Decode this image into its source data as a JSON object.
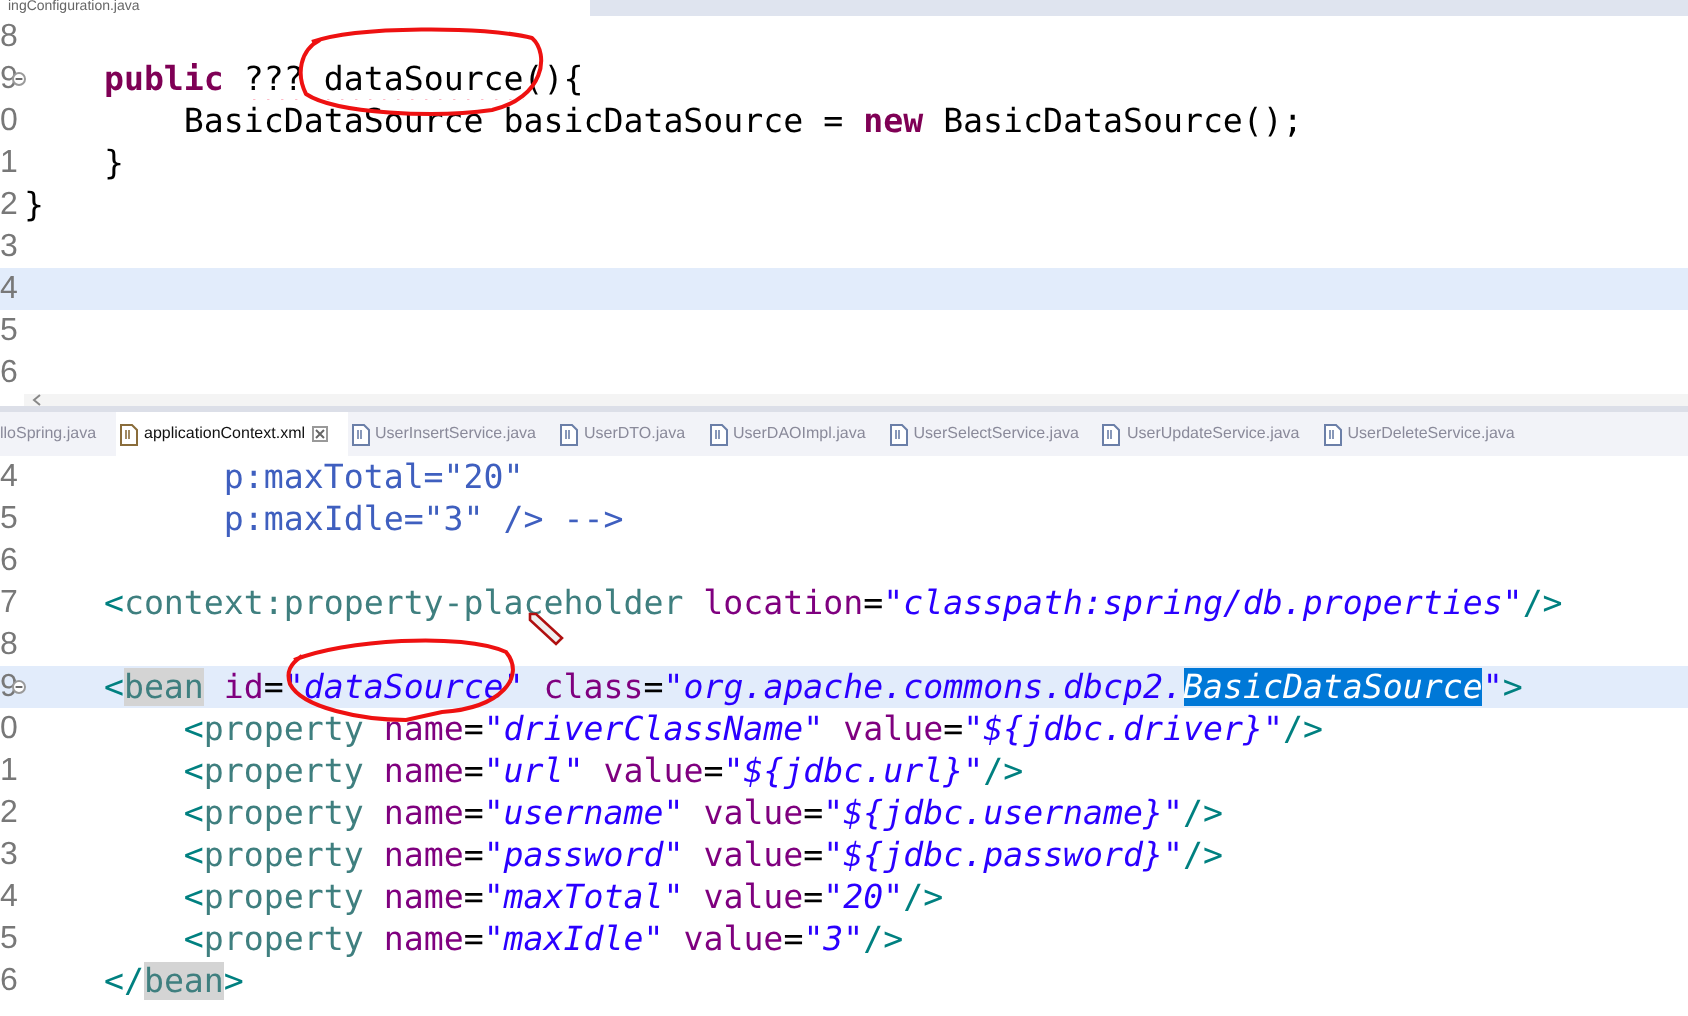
{
  "top_editor": {
    "tab": {
      "label": "ingConfiguration.java",
      "selected": true
    },
    "lines": [
      {
        "number": "8",
        "current": false
      },
      {
        "number": "9",
        "current": false,
        "foldable": true,
        "tokens": [
          {
            "kind": "keyword",
            "text": "    public "
          },
          {
            "kind": "error",
            "text": "???"
          },
          {
            "kind": "error",
            "text": " dataSource"
          },
          {
            "kind": "plain",
            "text": "(){"
          }
        ]
      },
      {
        "number": "0",
        "current": false,
        "tokens": [
          {
            "kind": "plain",
            "text": "        BasicDataSource basicDataSource = "
          },
          {
            "kind": "keyword",
            "text": "new"
          },
          {
            "kind": "plain",
            "text": " BasicDataSource();"
          }
        ]
      },
      {
        "number": "1",
        "current": false,
        "tokens": [
          {
            "kind": "plain",
            "text": "    }"
          }
        ]
      },
      {
        "number": "2",
        "current": false,
        "tokens": [
          {
            "kind": "plain",
            "text": "}"
          }
        ]
      },
      {
        "number": "3",
        "current": false
      },
      {
        "number": "4",
        "current": true
      },
      {
        "number": "5",
        "current": false
      },
      {
        "number": "6",
        "current": false
      }
    ]
  },
  "bottom_editor": {
    "tabs": [
      {
        "label": "lloSpring.java",
        "selected": false
      },
      {
        "label": "applicationContext.xml",
        "selected": true,
        "kind": "xml"
      },
      {
        "label": "UserInsertService.java",
        "selected": false,
        "kind": "java"
      },
      {
        "label": "UserDTO.java",
        "selected": false,
        "kind": "java"
      },
      {
        "label": "UserDAOImpl.java",
        "selected": false,
        "kind": "java"
      },
      {
        "label": "UserSelectService.java",
        "selected": false,
        "kind": "java"
      },
      {
        "label": "UserUpdateService.java",
        "selected": false,
        "kind": "java"
      },
      {
        "label": "UserDeleteService.java",
        "selected": false,
        "kind": "java"
      }
    ],
    "lines": [
      {
        "number": "4",
        "current": false,
        "tokens": [
          {
            "kind": "comment",
            "text": "          p:maxTotal=\"20\""
          }
        ]
      },
      {
        "number": "5",
        "current": false,
        "tokens": [
          {
            "kind": "comment",
            "text": "          p:maxIdle=\"3\" /> -->"
          }
        ]
      },
      {
        "number": "6",
        "current": false
      },
      {
        "number": "7",
        "current": false,
        "tokens": [
          {
            "kind": "tag",
            "text": "    <"
          },
          {
            "kind": "tagname",
            "text": "context:property-placeholder"
          },
          {
            "kind": "attr",
            "text": " location"
          },
          {
            "kind": "plain",
            "text": "="
          },
          {
            "kind": "string",
            "text": "\"classpath:spring/db.properties\""
          },
          {
            "kind": "tag",
            "text": "/>"
          }
        ]
      },
      {
        "number": "8",
        "current": false
      },
      {
        "number": "9",
        "current": true,
        "foldable": true,
        "tokens": [
          {
            "kind": "tag",
            "text": "    <"
          },
          {
            "kind": "occurrence",
            "text": "bean"
          },
          {
            "kind": "attr",
            "text": " id"
          },
          {
            "kind": "plain",
            "text": "="
          },
          {
            "kind": "string",
            "text": "\"dataSource\""
          },
          {
            "kind": "attr",
            "text": " class"
          },
          {
            "kind": "plain",
            "text": "="
          },
          {
            "kind": "string",
            "text": "\"org.apache.commons.dbcp2."
          },
          {
            "kind": "selection",
            "text": "BasicDataSource"
          },
          {
            "kind": "string",
            "text": "\""
          },
          {
            "kind": "tag",
            "text": ">"
          }
        ]
      },
      {
        "number": "0",
        "current": false,
        "tokens": [
          {
            "kind": "tag",
            "text": "        <"
          },
          {
            "kind": "tagname",
            "text": "property"
          },
          {
            "kind": "attr",
            "text": " name"
          },
          {
            "kind": "plain",
            "text": "="
          },
          {
            "kind": "string",
            "text": "\"driverClassName\""
          },
          {
            "kind": "attr",
            "text": " value"
          },
          {
            "kind": "plain",
            "text": "="
          },
          {
            "kind": "string",
            "text": "\"${jdbc.driver}\""
          },
          {
            "kind": "tag",
            "text": "/>"
          }
        ]
      },
      {
        "number": "1",
        "current": false,
        "tokens": [
          {
            "kind": "tag",
            "text": "        <"
          },
          {
            "kind": "tagname",
            "text": "property"
          },
          {
            "kind": "attr",
            "text": " name"
          },
          {
            "kind": "plain",
            "text": "="
          },
          {
            "kind": "string",
            "text": "\"url\""
          },
          {
            "kind": "attr",
            "text": " value"
          },
          {
            "kind": "plain",
            "text": "="
          },
          {
            "kind": "string",
            "text": "\"${jdbc.url}\""
          },
          {
            "kind": "tag",
            "text": "/>"
          }
        ]
      },
      {
        "number": "2",
        "current": false,
        "tokens": [
          {
            "kind": "tag",
            "text": "        <"
          },
          {
            "kind": "tagname",
            "text": "property"
          },
          {
            "kind": "attr",
            "text": " name"
          },
          {
            "kind": "plain",
            "text": "="
          },
          {
            "kind": "string",
            "text": "\"username\""
          },
          {
            "kind": "attr",
            "text": " value"
          },
          {
            "kind": "plain",
            "text": "="
          },
          {
            "kind": "string",
            "text": "\"${jdbc.username}\""
          },
          {
            "kind": "tag",
            "text": "/>"
          }
        ]
      },
      {
        "number": "3",
        "current": false,
        "tokens": [
          {
            "kind": "tag",
            "text": "        <"
          },
          {
            "kind": "tagname",
            "text": "property"
          },
          {
            "kind": "attr",
            "text": " name"
          },
          {
            "kind": "plain",
            "text": "="
          },
          {
            "kind": "string",
            "text": "\"password\""
          },
          {
            "kind": "attr",
            "text": " value"
          },
          {
            "kind": "plain",
            "text": "="
          },
          {
            "kind": "string",
            "text": "\"${jdbc.password}\""
          },
          {
            "kind": "tag",
            "text": "/>"
          }
        ]
      },
      {
        "number": "4",
        "current": false,
        "tokens": [
          {
            "kind": "tag",
            "text": "        <"
          },
          {
            "kind": "tagname",
            "text": "property"
          },
          {
            "kind": "attr",
            "text": " name"
          },
          {
            "kind": "plain",
            "text": "="
          },
          {
            "kind": "string",
            "text": "\"maxTotal\""
          },
          {
            "kind": "attr",
            "text": " value"
          },
          {
            "kind": "plain",
            "text": "="
          },
          {
            "kind": "string",
            "text": "\"20\""
          },
          {
            "kind": "tag",
            "text": "/>"
          }
        ]
      },
      {
        "number": "5",
        "current": false,
        "tokens": [
          {
            "kind": "tag",
            "text": "        <"
          },
          {
            "kind": "tagname",
            "text": "property"
          },
          {
            "kind": "attr",
            "text": " name"
          },
          {
            "kind": "plain",
            "text": "="
          },
          {
            "kind": "string",
            "text": "\"maxIdle\""
          },
          {
            "kind": "attr",
            "text": " value"
          },
          {
            "kind": "plain",
            "text": "="
          },
          {
            "kind": "string",
            "text": "\"3\""
          },
          {
            "kind": "tag",
            "text": "/>"
          }
        ]
      },
      {
        "number": "6",
        "current": false,
        "tokens": [
          {
            "kind": "tag",
            "text": "    </"
          },
          {
            "kind": "occurrence",
            "text": "bean"
          },
          {
            "kind": "tag",
            "text": ">"
          }
        ]
      }
    ]
  }
}
